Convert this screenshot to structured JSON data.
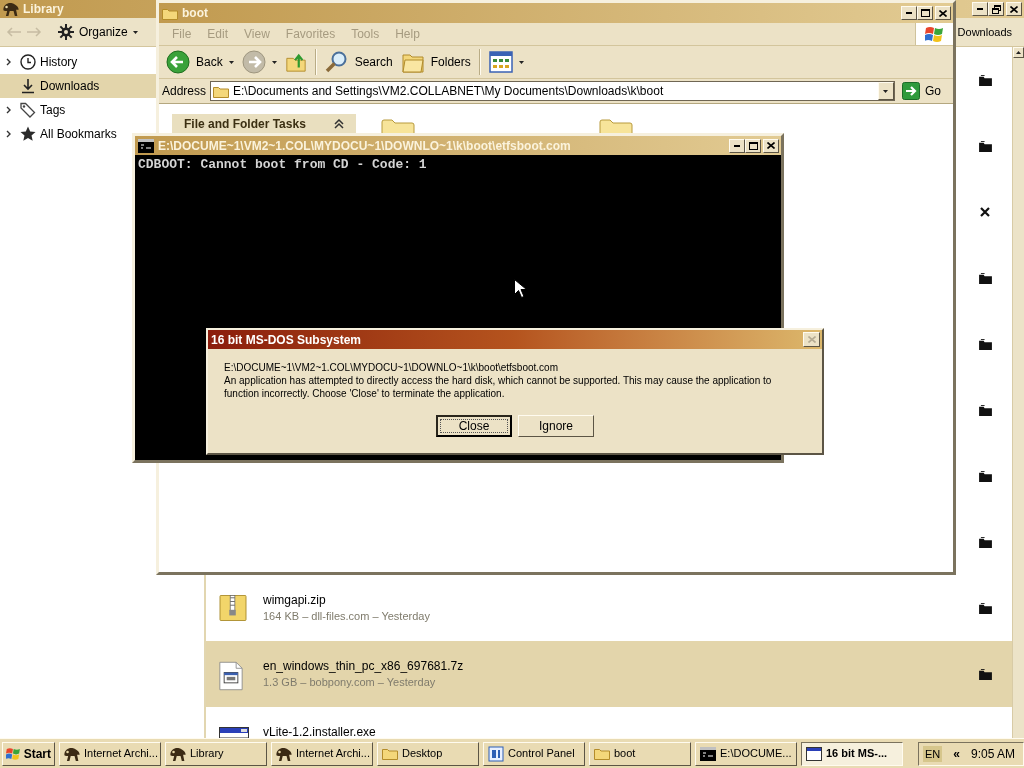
{
  "library_window": {
    "title": "Library",
    "active": false,
    "maximized": true,
    "nav_buttons": [
      {
        "kind": "back",
        "disabled": true
      },
      {
        "kind": "forward",
        "disabled": true
      }
    ],
    "organize": "Organize",
    "toolbar_label": "Downloads",
    "sidebar": {
      "items": [
        {
          "kind": "history",
          "label": "History",
          "expandable": true,
          "selected": false
        },
        {
          "kind": "downloads",
          "label": "Downloads",
          "expandable": false,
          "selected": true
        },
        {
          "kind": "tags",
          "label": "Tags",
          "expandable": true,
          "selected": false
        },
        {
          "kind": "bookmarks",
          "label": "All Bookmarks",
          "expandable": true,
          "selected": false
        }
      ]
    },
    "downloads": [
      {
        "in_progress": false,
        "selected": false
      },
      {
        "in_progress": false,
        "selected": false
      },
      {
        "in_progress": true,
        "selected": false
      },
      {
        "in_progress": false,
        "selected": false
      },
      {
        "in_progress": false,
        "selected": false
      },
      {
        "in_progress": false,
        "selected": false
      },
      {
        "in_progress": false,
        "selected": false
      },
      {
        "in_progress": false,
        "selected": false
      },
      {
        "kind": "zip",
        "name": "wimgapi.zip",
        "detail": "164 KB – dll-files.com – Yesterday",
        "in_progress": false,
        "selected": false
      },
      {
        "kind": "archive",
        "name": "en_windows_thin_pc_x86_697681.7z",
        "detail": "1.3 GB – bobpony.com – Yesterday",
        "in_progress": false,
        "selected": true
      },
      {
        "kind": "installer",
        "name": "vLite-1.2.installer.exe",
        "selected": false
      }
    ]
  },
  "explorer_window": {
    "title": "boot",
    "active": false,
    "maximized": false,
    "menu": [
      "File",
      "Edit",
      "View",
      "Favorites",
      "Tools",
      "Help"
    ],
    "toolbar": [
      {
        "kind": "back",
        "label": "Back",
        "disabled": false,
        "menu": true
      },
      {
        "kind": "forward",
        "disabled": true,
        "menu": true
      },
      {
        "kind": "up",
        "disabled": false,
        "menu": false
      },
      {
        "kind": "search",
        "label": "Search",
        "disabled": false,
        "menu": false
      },
      {
        "kind": "folders",
        "label": "Folders",
        "disabled": false,
        "menu": false
      },
      {
        "kind": "views",
        "disabled": false,
        "menu": true
      }
    ],
    "address": {
      "label": "Address",
      "value": "E:\\Documents and Settings\\VM2.COLLABNET\\My Documents\\Downloads\\k\\boot",
      "go": "Go"
    },
    "tasks_panel": {
      "title": "File and Folder Tasks"
    }
  },
  "console_window": {
    "title": "E:\\DOCUME~1\\VM2~1.COL\\MYDOCU~1\\DOWNLO~1\\k\\boot\\etfsboot.com",
    "active": false,
    "maximized": false,
    "lines": [
      "CDBOOT: Cannot boot from CD - Code: 1"
    ]
  },
  "dialog": {
    "title": "16 bit MS-DOS Subsystem",
    "active": true,
    "close_disabled": true,
    "message": [
      "E:\\DOCUME~1\\VM2~1.COL\\MYDOCU~1\\DOWNLO~1\\k\\boot\\etfsboot.com",
      "An application has attempted to directly access the hard disk, which cannot be supported. This may cause the application to function incorrectly. Choose 'Close' to terminate the application."
    ],
    "buttons": [
      {
        "label": "Close",
        "default": true
      },
      {
        "label": "Ignore",
        "default": false
      }
    ]
  },
  "taskbar": {
    "start": "Start",
    "buttons": [
      {
        "kind": "browser",
        "label": "Internet Archi...",
        "selected": false
      },
      {
        "kind": "browser",
        "label": "Library",
        "selected": false
      },
      {
        "kind": "browser",
        "label": "Internet Archi...",
        "selected": false
      },
      {
        "kind": "folder",
        "label": "Desktop",
        "selected": false
      },
      {
        "kind": "control_panel",
        "label": "Control Panel",
        "selected": false
      },
      {
        "kind": "folder",
        "label": "boot",
        "selected": false
      },
      {
        "kind": "console",
        "label": "E:\\DOCUME...",
        "selected": false
      },
      {
        "kind": "window",
        "label": "16 bit MS-...",
        "selected": true
      }
    ],
    "tray": {
      "language": "EN",
      "expand": "«",
      "clock": "9:05 AM"
    }
  }
}
